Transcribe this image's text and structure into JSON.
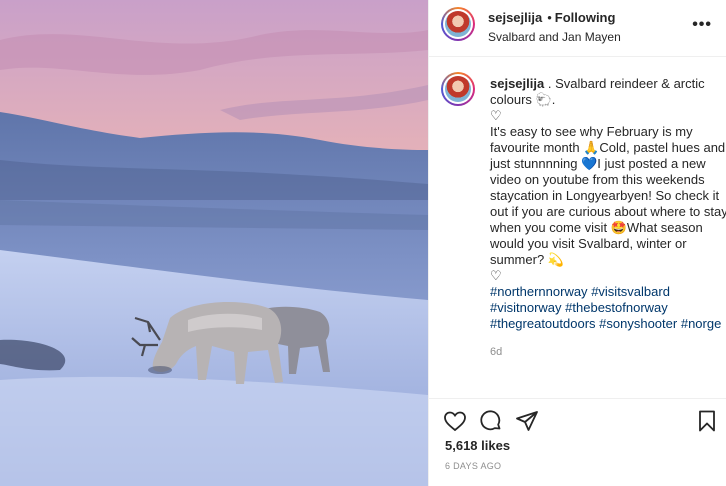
{
  "post": {
    "username": "sejsejlija",
    "separator": "•",
    "follow_label": "Following",
    "location": "Svalbard and Jan Mayen",
    "more_label": "•••"
  },
  "caption": {
    "username": "sejsejlija",
    "lines": [
      ". Svalbard reindeer & arctic colours 🐑.",
      "♡",
      "It's easy to see why February is my favourite month 🙏Cold, pastel hues and just stunnnning 💙I just posted a new video on youtube from this weekends staycation in Longyearbyen! So check it out if you are curious about where to stay when you come visit 🤩What season would you visit Svalbard, winter or summer? 💫",
      "♡"
    ],
    "hashtags": [
      "#northernnorway",
      "#visitsvalbard",
      "#visitnorway",
      "#thebestofnorway",
      "#thegreatoutdoors",
      "#sonyshooter",
      "#norge"
    ],
    "age": "6d"
  },
  "actions": {
    "likes": "5,618 likes",
    "timestamp": "6 DAYS AGO",
    "icons": [
      "heart-icon",
      "comment-icon",
      "share-icon",
      "bookmark-icon"
    ]
  },
  "colors": {
    "link": "#00376b",
    "muted": "#8e8e8e",
    "text": "#262626"
  }
}
